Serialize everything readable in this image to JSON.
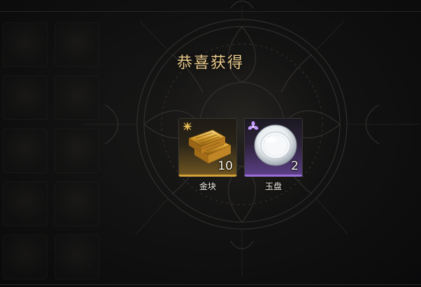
{
  "popup": {
    "title": "恭喜获得"
  },
  "rewards": [
    {
      "name": "金块",
      "count": "10",
      "rarity_color": "#d4a23a",
      "icon": "gold-bars-icon"
    },
    {
      "name": "玉盘",
      "count": "2",
      "rarity_color": "#9a6fd8",
      "icon": "jade-plate-icon"
    }
  ]
}
